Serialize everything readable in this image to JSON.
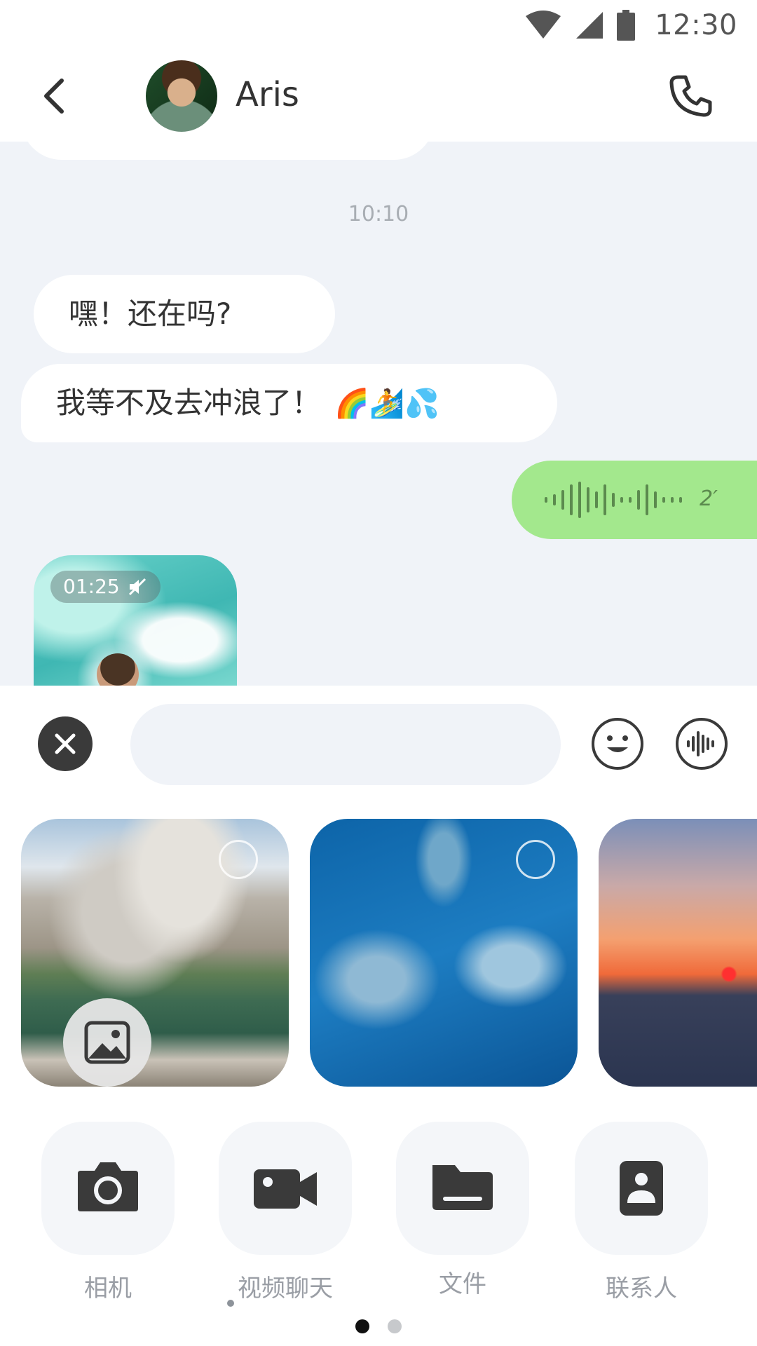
{
  "status_bar": {
    "time": "12:30",
    "icons": [
      "wifi-icon",
      "signal-icon",
      "battery-icon"
    ]
  },
  "header": {
    "contact_name": "Aris",
    "back_icon": "chevron-left-icon",
    "call_icon": "phone-icon"
  },
  "chat": {
    "timestamp": "10:10",
    "messages": [
      {
        "direction": "incoming",
        "type": "text",
        "text": "嘿！还在吗?"
      },
      {
        "direction": "incoming",
        "type": "text",
        "text": "我等不及去冲浪了！",
        "emoji": "🌈🏄💦"
      },
      {
        "direction": "outgoing",
        "type": "voice",
        "duration": "2′"
      },
      {
        "direction": "incoming",
        "type": "video",
        "duration": "01:25",
        "muted": true
      }
    ]
  },
  "composer": {
    "close_icon": "close-icon",
    "input_value": "",
    "input_placeholder": "",
    "emoji_icon": "smiley-icon",
    "voice_icon": "voice-wave-icon"
  },
  "photo_picker": {
    "items": [
      "mountain-lake-photo",
      "dolphins-photo",
      "sunset-city-photo"
    ],
    "gallery_icon": "gallery-icon"
  },
  "actions": [
    {
      "label": "相机",
      "icon": "camera-icon"
    },
    {
      "label": "视频聊天",
      "icon": "video-camera-icon"
    },
    {
      "label": "文件",
      "icon": "folder-icon"
    },
    {
      "label": "联系人",
      "icon": "contact-card-icon"
    }
  ],
  "pager": {
    "current_page": 1,
    "total_pages": 2
  },
  "colors": {
    "chat_background": "#f0f3f8",
    "outgoing_bubble": "#a3e88d",
    "incoming_bubble": "#ffffff",
    "icon_dark": "#3a3a3a"
  }
}
